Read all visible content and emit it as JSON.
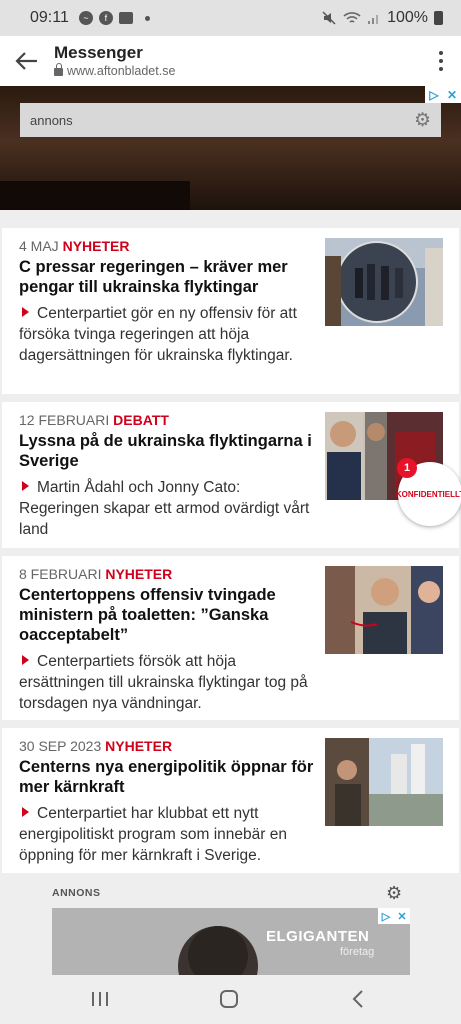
{
  "status_bar": {
    "time": "09:11",
    "battery": "100%"
  },
  "toolbar": {
    "title": "Messenger",
    "url": "www.aftonbladet.se"
  },
  "ad_top": {
    "label": "annons"
  },
  "articles": [
    {
      "date": "4 MAJ",
      "category": "NYHETER",
      "headline": "C pressar regeringen – kräver mer pengar till ukrainska flyktingar",
      "summary": "Centerpartiet gör en ny offensiv för att försöka tvinga regeringen att höja dagersättningen för ukrainska flyktingar."
    },
    {
      "date": "12 FEBRUARI",
      "category": "DEBATT",
      "headline": "Lyssna på de ukrainska flyktingarna i Sverige",
      "summary": "Martin Ådahl och Jonny Cato: Regeringen skapar ett armod ovärdigt vårt land"
    },
    {
      "date": "8 FEBRUARI",
      "category": "NYHETER",
      "headline": "Centertoppens offensiv tvingade ministern på toaletten: ”Ganska oacceptabelt”",
      "summary": "Centerpartiets försök att höja ersättningen till ukrainska flyktingar tog på torsdagen nya vändningar."
    },
    {
      "date": "30 SEP 2023",
      "category": "NYHETER",
      "headline": "Centerns nya energipolitik öppnar för mer kärnkraft",
      "summary": "Centerpartiet har klubbat ett nytt energipolitiskt program som innebär en öppning för mer kärnkraft i Sverige."
    }
  ],
  "konfidentiellt": {
    "count": "1",
    "label": "KONFIDENTIELLT"
  },
  "ad_bottom": {
    "label": "ANNONS",
    "brand": "ELGIGANTEN",
    "sub": "företag"
  }
}
